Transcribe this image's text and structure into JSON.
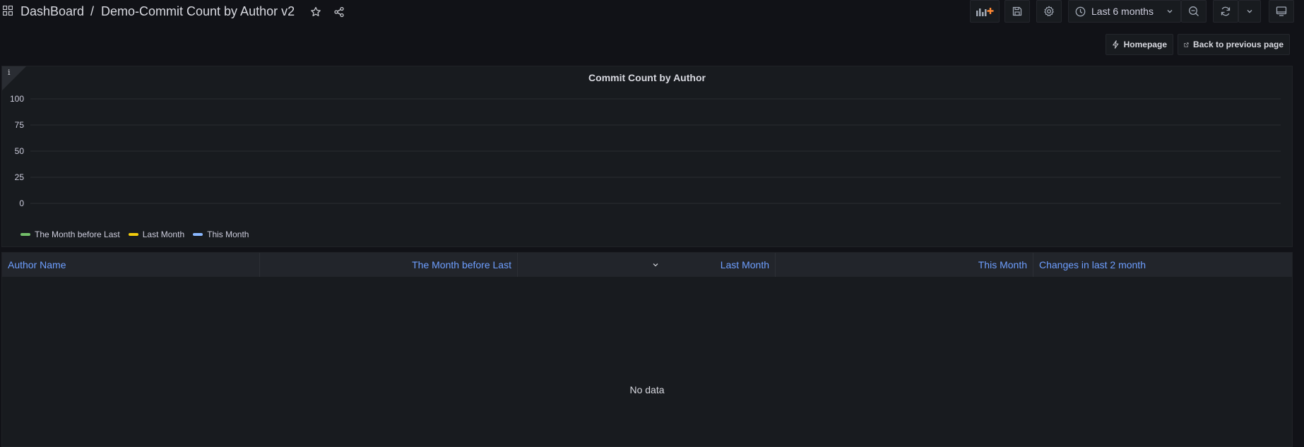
{
  "header": {
    "breadcrumb_root": "DashBoard",
    "breadcrumb_sep": "/",
    "dashboard_title": "Demo-Commit Count by Author v2"
  },
  "toolbar": {
    "time_range": "Last 6 months"
  },
  "links": {
    "homepage": "Homepage",
    "back": "Back to previous page"
  },
  "chart_panel": {
    "info": "i"
  },
  "chart_data": {
    "type": "line",
    "title": "Commit Count by Author",
    "xlabel": "",
    "ylabel": "",
    "ylim": [
      0,
      100
    ],
    "yticks": [
      "100",
      "75",
      "50",
      "25",
      "0"
    ],
    "grid": true,
    "legend_position": "bottom-left",
    "series": [
      {
        "name": "The Month before Last",
        "color": "#73bf69",
        "values": []
      },
      {
        "name": "Last Month",
        "color": "#f2cc0c",
        "values": []
      },
      {
        "name": "This Month",
        "color": "#8ab8ff",
        "values": []
      }
    ]
  },
  "table": {
    "columns": [
      "Author Name",
      "The Month before Last",
      "Last Month",
      "This Month",
      "Changes in last 2 month"
    ],
    "rows": [],
    "empty_text": "No data"
  },
  "colors": {
    "background": "#111217",
    "panel": "#181b1f",
    "link_blue": "#6e9fff",
    "add_panel_accent": "#ff8833"
  },
  "icons": [
    "apps-icon",
    "star-icon",
    "share-icon",
    "add-panel-icon",
    "save-icon",
    "gear-icon",
    "clock-icon",
    "chevron-down-icon",
    "zoom-out-icon",
    "refresh-icon",
    "tv-icon",
    "bolt-icon",
    "external-link-icon"
  ]
}
